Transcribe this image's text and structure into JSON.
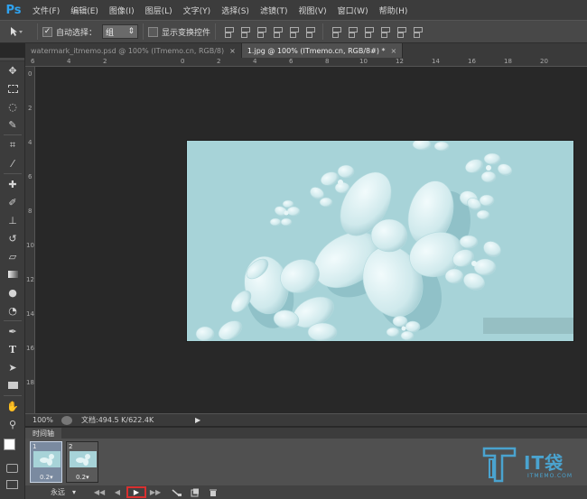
{
  "app": {
    "logo": "Ps"
  },
  "menu": [
    "文件(F)",
    "编辑(E)",
    "图像(I)",
    "图层(L)",
    "文字(Y)",
    "选择(S)",
    "滤镜(T)",
    "视图(V)",
    "窗口(W)",
    "帮助(H)"
  ],
  "options": {
    "auto_select_label": "自动选择：",
    "auto_select_value": "组",
    "show_transform_label": "显示变换控件"
  },
  "tabs": [
    {
      "label": "watermark_itmemo.psd @ 100% (ITmemo.cn, RGB/8)",
      "close": "×"
    },
    {
      "label": "1.jpg @ 100% (ITmemo.cn, RGB/8#) *",
      "close": "×"
    }
  ],
  "rulers": {
    "top": [
      "6",
      "4",
      "2",
      "0",
      "2",
      "4",
      "6",
      "8",
      "10",
      "12",
      "14",
      "16",
      "18",
      "20"
    ],
    "left": [
      "0",
      "2",
      "4",
      "6",
      "8",
      "10",
      "12",
      "14",
      "16",
      "18"
    ]
  },
  "status": {
    "zoom": "100%",
    "doc_info": "文档:494.5 K/622.4K",
    "arrow": "▶"
  },
  "timeline": {
    "tab_label": "时间轴",
    "frames": [
      {
        "num": "1",
        "time": "0.2▾"
      },
      {
        "num": "2",
        "time": "0.2▾"
      }
    ],
    "loop_label": "永远",
    "loop_arrow": "▾",
    "controls": {
      "first": "◀◀",
      "prev": "◀",
      "play": "▶",
      "next": "▶▶"
    }
  },
  "watermark": {
    "text": "IT袋",
    "url": "ITMEMO.COM"
  },
  "colors": {
    "accent": "#2fa3f0",
    "canvas_bg": "#a7d3d8",
    "petal": "#dff1f3",
    "play_highlight": "#d83030"
  },
  "icons": {
    "tools": [
      "move-icon",
      "marquee-icon",
      "lasso-icon",
      "quick-select-icon",
      "crop-icon",
      "eyedropper-icon",
      "healing-icon",
      "brush-icon",
      "stamp-icon",
      "history-brush-icon",
      "eraser-icon",
      "gradient-icon",
      "blur-icon",
      "dodge-icon",
      "pen-icon",
      "type-icon",
      "path-select-icon",
      "rectangle-icon",
      "hand-icon",
      "zoom-icon"
    ]
  }
}
